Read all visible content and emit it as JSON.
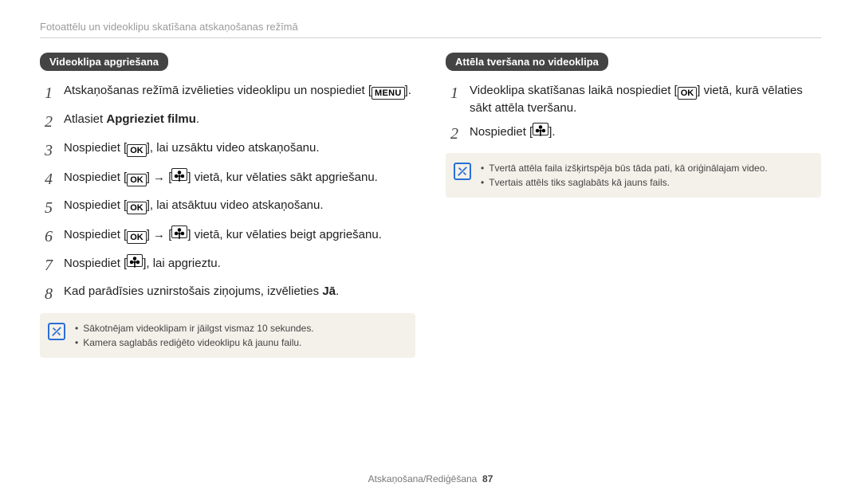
{
  "header": {
    "breadcrumb": "Fotoattēlu un videoklipu skatīšana atskaņošanas režīmā"
  },
  "left": {
    "pill": "Videoklipa apgriešana",
    "steps": [
      {
        "n": "1",
        "pre": "Atskaņošanas režīmā izvēlieties videoklipu un nospiediet [",
        "btn": "MENU",
        "post": "]."
      },
      {
        "n": "2",
        "pre": "Atlasiet ",
        "bold": "Apgrieziet filmu",
        "post2": "."
      },
      {
        "n": "3",
        "pre": "Nospiediet [",
        "btn": "OK",
        "post": "], lai uzsāktu video atskaņošanu."
      },
      {
        "n": "4",
        "pre": "Nospiediet [",
        "btn": "OK",
        "mid": "] → [",
        "flower": true,
        "post": "] vietā, kur vēlaties sākt apgriešanu."
      },
      {
        "n": "5",
        "pre": "Nospiediet [",
        "btn": "OK",
        "post": "], lai atsāktuu video atskaņošanu."
      },
      {
        "n": "6",
        "pre": "Nospiediet [",
        "btn": "OK",
        "mid": "] → [",
        "flower": true,
        "post": "] vietā, kur vēlaties beigt apgriešanu."
      },
      {
        "n": "7",
        "pre": "Nospiediet [",
        "flower_only": true,
        "post": "], lai apgrieztu."
      },
      {
        "n": "8",
        "pre": "Kad parādīsies uznirstošais ziņojums, izvēlieties ",
        "bold": "Jā",
        "post2": "."
      }
    ],
    "notes": [
      "Sākotnējam videoklipam ir jāilgst vismaz 10 sekundes.",
      "Kamera saglabās rediģēto videoklipu kā jaunu failu."
    ]
  },
  "right": {
    "pill": "Attēla tveršana no videoklipa",
    "steps": [
      {
        "n": "1",
        "pre": "Videoklipa skatīšanas laikā nospiediet [",
        "btn": "OK",
        "post": "] vietā, kurā vēlaties sākt attēla tveršanu."
      },
      {
        "n": "2",
        "pre": "Nospiediet [",
        "flower_only": true,
        "post": "]."
      }
    ],
    "notes": [
      "Tvertā attēla faila izšķirtspēja būs tāda pati, kā oriģinālajam video.",
      "Tvertais attēls tiks saglabāts kā jauns fails."
    ]
  },
  "footer": {
    "section": "Atskaņošana/Rediģēšana",
    "page": "87"
  }
}
